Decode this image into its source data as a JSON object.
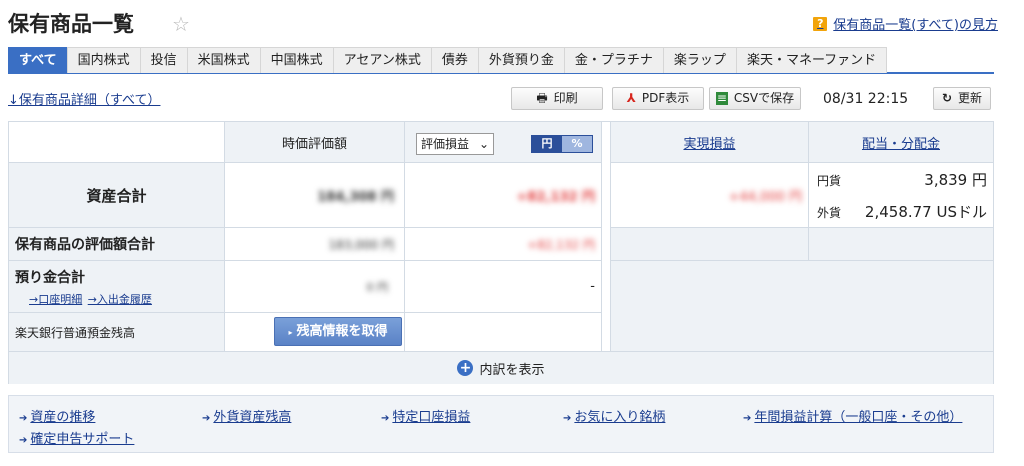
{
  "header": {
    "title": "保有商品一覧",
    "help_link": "保有商品一覧(すべて)の見方",
    "help_icon_label": "?"
  },
  "tabs": [
    {
      "label": "すべて",
      "active": true
    },
    {
      "label": "国内株式"
    },
    {
      "label": "投信"
    },
    {
      "label": "米国株式"
    },
    {
      "label": "中国株式"
    },
    {
      "label": "アセアン株式"
    },
    {
      "label": "債券"
    },
    {
      "label": "外貨預り金"
    },
    {
      "label": "金・プラチナ"
    },
    {
      "label": "楽ラップ"
    },
    {
      "label": "楽天・マネーファンド"
    }
  ],
  "toolbar": {
    "detail_link": "↓保有商品詳細（すべて）",
    "print": "印刷",
    "pdf": "PDF表示",
    "csv": "CSVで保存",
    "datetime": "08/31 22:15",
    "refresh": "更新"
  },
  "summary": {
    "col_market_value": "時価評価額",
    "select_value": "評価損益",
    "toggle_yen": "円",
    "toggle_pct": "%",
    "col_realized": "実現損益",
    "col_dividend": "配当・分配金",
    "rows": {
      "total_assets": "資産合計",
      "holdings_total": "保有商品の評価額合計",
      "deposits_total": "預り金合計",
      "account_detail_link": "→口座明細",
      "inout_history_link": "→入出金履歴",
      "bank_balance": "楽天銀行普通預金残高"
    },
    "masked": {
      "total_value": "184,308 円",
      "total_pl": "+82,132 円",
      "realized": "+44,000 円",
      "holdings_value": "183,000 円",
      "holdings_pl": "+82,132 円",
      "deposit_value": "0 円",
      "deposit_pl": "-"
    },
    "dividend": {
      "yen_label": "円貨",
      "yen_value": "3,839 円",
      "fx_label": "外貨",
      "fx_value": "2,458.77 USドル"
    },
    "get_balance_button": "残高情報を取得",
    "expand_label": "内訳を表示"
  },
  "bottom_links": [
    "資産の推移",
    "外貨資産残高",
    "特定口座損益",
    "お気に入り銘柄",
    "年間損益計算（一般口座・その他）",
    "確定申告サポート"
  ],
  "colors": {
    "accent": "#3a6fc4",
    "link": "#1a3c8f",
    "header_bg": "#eef2f6",
    "gain": "#e23b3b"
  }
}
